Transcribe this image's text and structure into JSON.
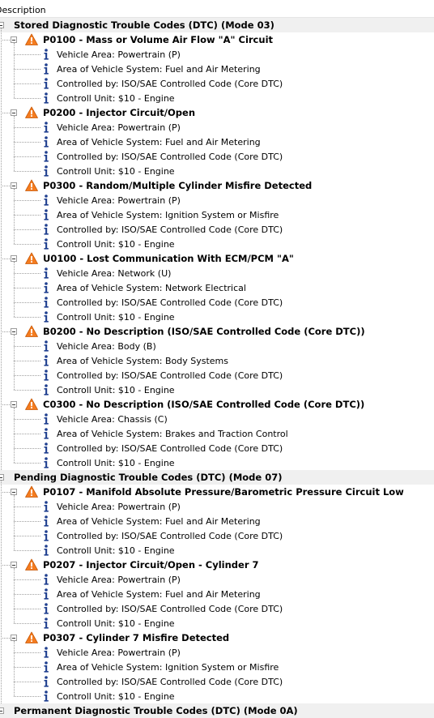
{
  "header": {
    "column": "Description"
  },
  "colors": {
    "warning": "#f57c1f",
    "info": "#1f3f8f",
    "category_bg": "#f0f0f0"
  },
  "categories": [
    {
      "label": "Stored Diagnostic Trouble Codes (DTC) (Mode 03)",
      "codes": [
        {
          "label": "P0100 - Mass or Volume Air Flow \"A\" Circuit",
          "details": [
            "Vehicle Area: Powertrain (P)",
            "Area of Vehicle System: Fuel and Air Metering",
            "Controlled by: ISO/SAE Controlled Code (Core DTC)",
            "Controll Unit: $10 - Engine"
          ]
        },
        {
          "label": "P0200 - Injector Circuit/Open",
          "details": [
            "Vehicle Area: Powertrain (P)",
            "Area of Vehicle System: Fuel and Air Metering",
            "Controlled by: ISO/SAE Controlled Code (Core DTC)",
            "Controll Unit: $10 - Engine"
          ]
        },
        {
          "label": "P0300 - Random/Multiple Cylinder Misfire Detected",
          "details": [
            "Vehicle Area: Powertrain (P)",
            "Area of Vehicle System: Ignition System or Misfire",
            "Controlled by: ISO/SAE Controlled Code (Core DTC)",
            "Controll Unit: $10 - Engine"
          ]
        },
        {
          "label": "U0100 - Lost Communication With ECM/PCM \"A\"",
          "details": [
            "Vehicle Area: Network (U)",
            "Area of Vehicle System: Network Electrical",
            "Controlled by: ISO/SAE Controlled Code (Core DTC)",
            "Controll Unit: $10 - Engine"
          ]
        },
        {
          "label": "B0200 - No Description (ISO/SAE Controlled Code (Core DTC))",
          "details": [
            "Vehicle Area: Body (B)",
            "Area of Vehicle System: Body Systems",
            "Controlled by: ISO/SAE Controlled Code (Core DTC)",
            "Controll Unit: $10 - Engine"
          ]
        },
        {
          "label": "C0300 - No Description (ISO/SAE Controlled Code (Core DTC))",
          "details": [
            "Vehicle Area: Chassis (C)",
            "Area of Vehicle System: Brakes and Traction Control",
            "Controlled by: ISO/SAE Controlled Code (Core DTC)",
            "Controll Unit: $10 - Engine"
          ]
        }
      ]
    },
    {
      "label": "Pending Diagnostic Trouble Codes (DTC) (Mode 07)",
      "codes": [
        {
          "label": "P0107 - Manifold Absolute Pressure/Barometric Pressure Circuit Low",
          "details": [
            "Vehicle Area: Powertrain (P)",
            "Area of Vehicle System: Fuel and Air Metering",
            "Controlled by: ISO/SAE Controlled Code (Core DTC)",
            "Controll Unit: $10 - Engine"
          ]
        },
        {
          "label": "P0207 - Injector Circuit/Open - Cylinder 7",
          "details": [
            "Vehicle Area: Powertrain (P)",
            "Area of Vehicle System: Fuel and Air Metering",
            "Controlled by: ISO/SAE Controlled Code (Core DTC)",
            "Controll Unit: $10 - Engine"
          ]
        },
        {
          "label": "P0307 - Cylinder 7 Misfire Detected",
          "details": [
            "Vehicle Area: Powertrain (P)",
            "Area of Vehicle System: Ignition System or Misfire",
            "Controlled by: ISO/SAE Controlled Code (Core DTC)",
            "Controll Unit: $10 - Engine"
          ]
        }
      ]
    },
    {
      "label": "Permanent Diagnostic Trouble Codes (DTC) (Mode 0A)",
      "codes": []
    }
  ]
}
